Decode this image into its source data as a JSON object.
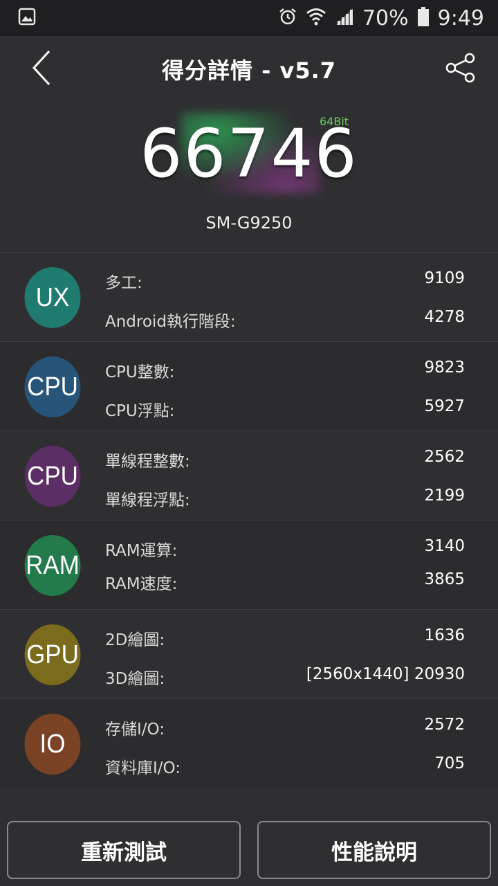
{
  "status_bar": {
    "battery": "70%",
    "time": "9:49",
    "icons": [
      "image-icon",
      "alarm-icon",
      "wifi-icon",
      "signal-icon",
      "battery-icon"
    ]
  },
  "header": {
    "title": "得分詳情 - v5.7",
    "back_icon": "back-chevron-icon",
    "share_icon": "share-icon"
  },
  "score": {
    "total": "66746",
    "bit": "64Bit",
    "device": "SM-G9250"
  },
  "results": [
    {
      "badge": "UX",
      "color": "#1f7a70",
      "items": [
        {
          "label": "多工:",
          "value": "9109"
        },
        {
          "label": "Android執行階段:",
          "value": "4278"
        }
      ]
    },
    {
      "badge": "CPU",
      "color": "#27557a",
      "items": [
        {
          "label": "CPU整數:",
          "value": "9823"
        },
        {
          "label": "CPU浮點:",
          "value": "5927"
        }
      ]
    },
    {
      "badge": "CPU",
      "color": "#5b2e66",
      "items": [
        {
          "label": "單線程整數:",
          "value": "2562"
        },
        {
          "label": "單線程浮點:",
          "value": "2199"
        }
      ]
    },
    {
      "badge": "RAM",
      "color": "#237a4a",
      "items": [
        {
          "label": "RAM運算:",
          "value": "3140"
        },
        {
          "label": "RAM速度:",
          "value": "3865"
        }
      ]
    },
    {
      "badge": "GPU",
      "color": "#7a6b1d",
      "items": [
        {
          "label": "2D繪圖:",
          "value": "1636"
        },
        {
          "label": "3D繪圖:",
          "value": "[2560x1440] 20930"
        }
      ]
    },
    {
      "badge": "IO",
      "color": "#7a4325",
      "items": [
        {
          "label": "存儲I/O:",
          "value": "2572"
        },
        {
          "label": "資料庫I/O:",
          "value": "705"
        }
      ]
    }
  ],
  "buttons": {
    "retest": "重新測試",
    "info": "性能說明"
  }
}
